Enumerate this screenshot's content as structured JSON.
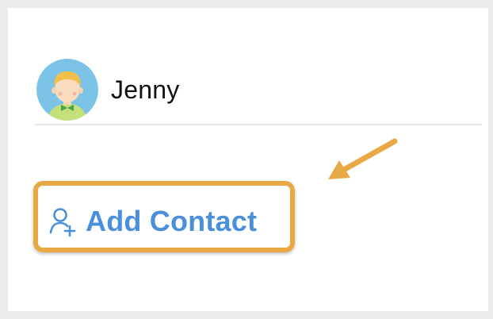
{
  "contact": {
    "name": "Jenny",
    "avatar_icon": "cartoon-boy-avatar"
  },
  "actions": {
    "add_contact_label": "Add Contact",
    "add_contact_icon": "person-add-icon"
  },
  "colors": {
    "accent_blue": "#4a8fd9",
    "highlight_orange": "#e8a945",
    "background": "#ececee"
  }
}
